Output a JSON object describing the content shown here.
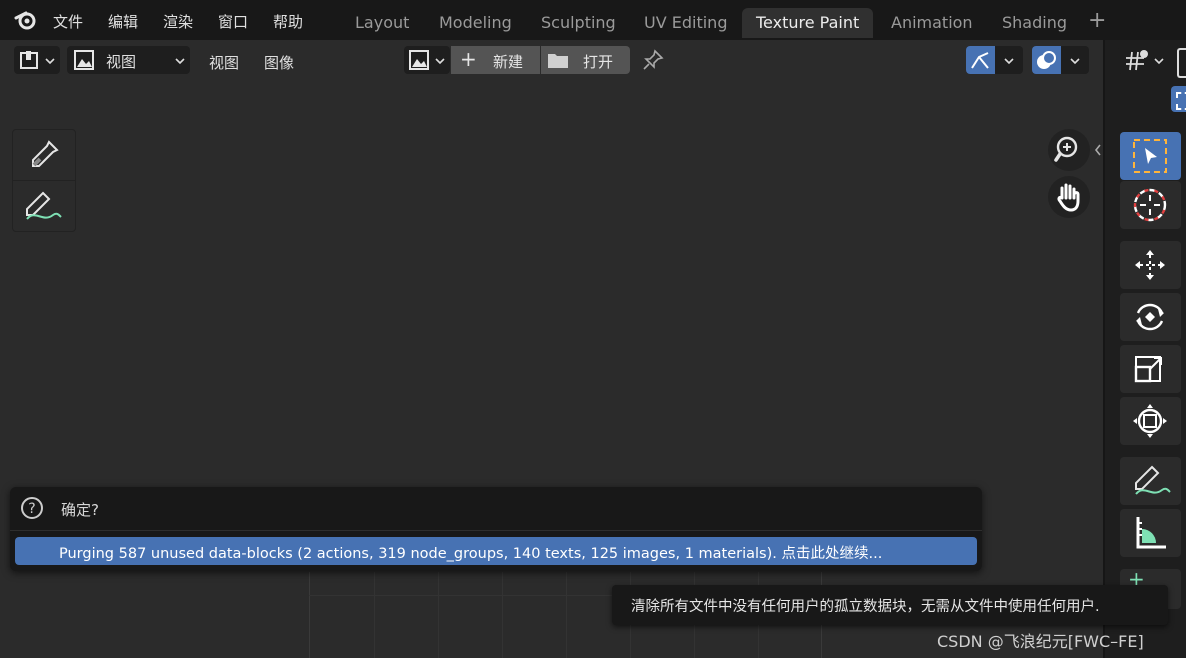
{
  "menu": [
    "文件",
    "编辑",
    "渲染",
    "窗口",
    "帮助"
  ],
  "workspace_tabs": [
    "Layout",
    "Modeling",
    "Sculpting",
    "UV Editing",
    "Texture Paint",
    "Animation",
    "Shading"
  ],
  "active_tab": "Texture Paint",
  "header": {
    "view_dropdown": "视图",
    "view_menu": "视图",
    "image_menu": "图像",
    "new_label": "新建",
    "open_label": "打开"
  },
  "dialog": {
    "title": "确定?",
    "message": "Purging 587 unused data-blocks (2 actions, 319 node_groups, 140 texts, 125 images, 1 materials). 点击此处继续..."
  },
  "tooltip": "清除所有文件中没有任何用户的孤立数据块，无需从文件中使用任何用户.",
  "watermark": "CSDN @飞浪纪元[FWC–FE]",
  "colors": {
    "accent": "#4772b3",
    "background": "#2b2b2b",
    "topbar": "#181818"
  }
}
